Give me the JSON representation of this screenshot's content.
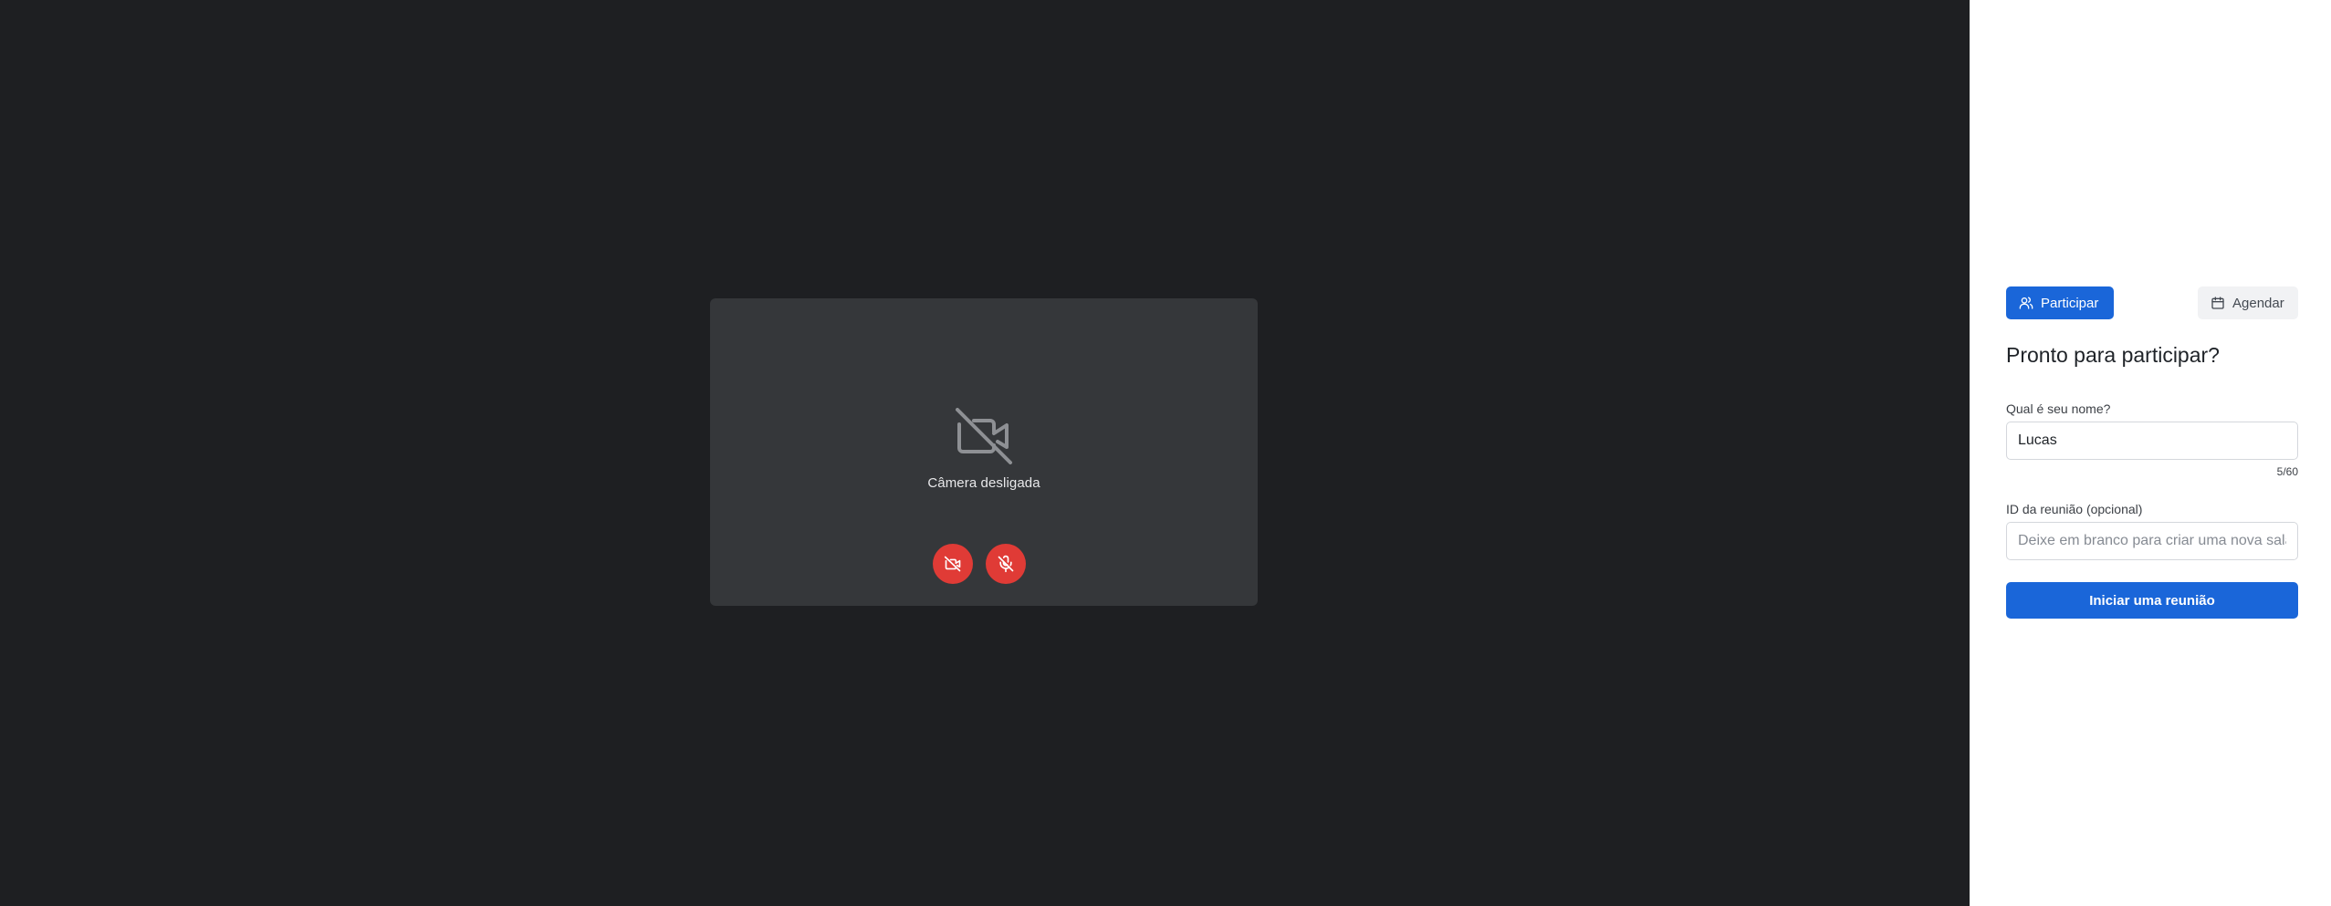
{
  "preview": {
    "camera_off_label": "Câmera desligada",
    "camera_off_icon": "video-off-icon",
    "controls": [
      {
        "icon": "video-off-icon",
        "color": "#e03b36"
      },
      {
        "icon": "mic-off-icon",
        "color": "#e03b36"
      }
    ]
  },
  "panel": {
    "tabs": [
      {
        "label": "Participar",
        "icon": "users-icon",
        "active": true
      },
      {
        "label": "Agendar",
        "icon": "calendar-icon",
        "active": false
      }
    ],
    "heading": "Pronto para participar?",
    "name_field": {
      "label": "Qual é seu nome?",
      "value": "Lucas",
      "counter": "5/60"
    },
    "meeting_id_field": {
      "label": "ID da reunião (opcional)",
      "value": "",
      "placeholder": "Deixe em branco para criar uma nova sala"
    },
    "submit_label": "Iniciar uma reunião"
  },
  "colors": {
    "stage_bg": "#1e1f22",
    "preview_bg": "#35373a",
    "accent": "#1a66d9",
    "danger": "#e03b36"
  }
}
